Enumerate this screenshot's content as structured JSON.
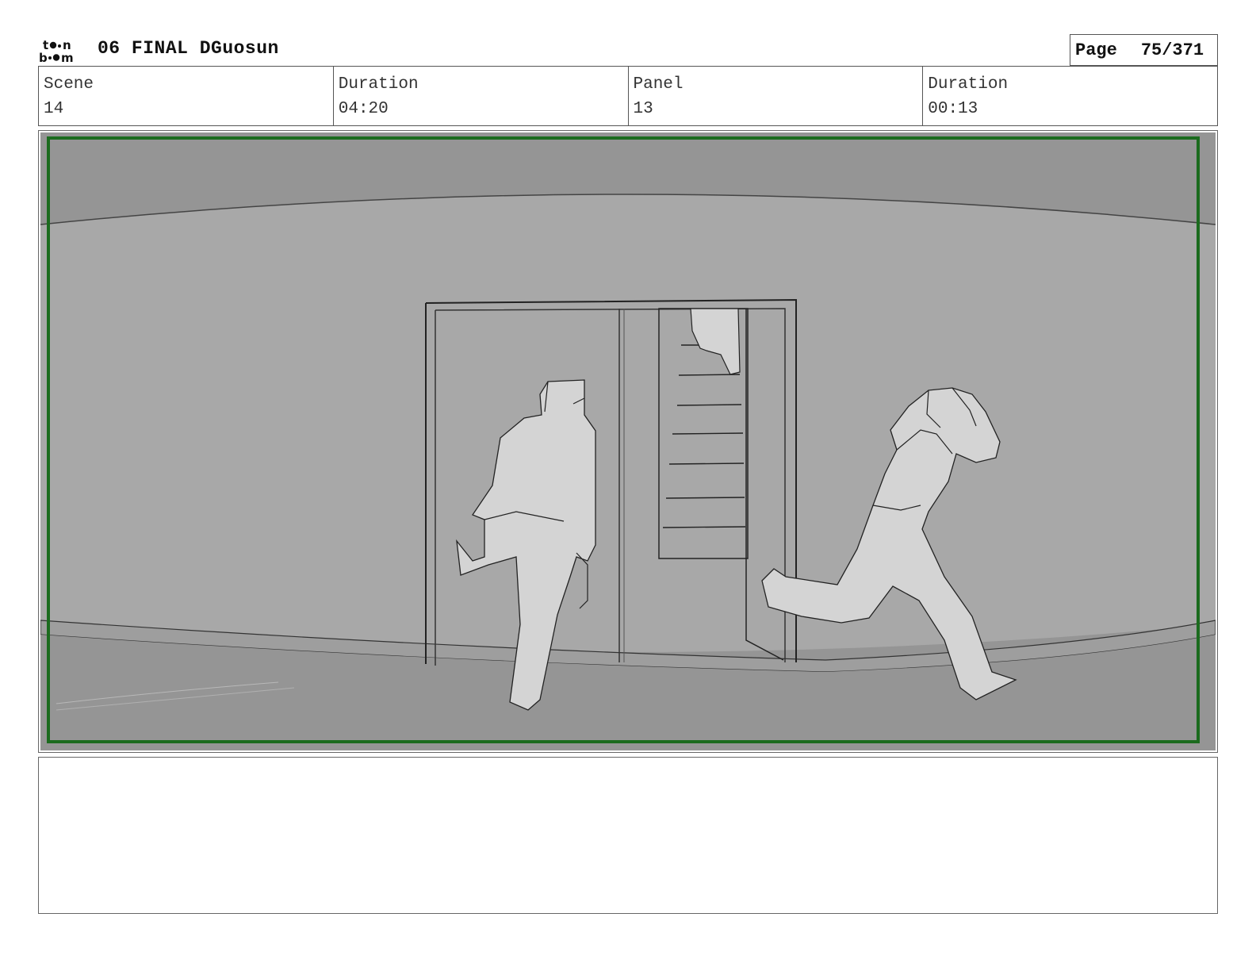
{
  "header": {
    "logo_text_top": "toon",
    "logo_text_bottom": "boom",
    "title": "06 FINAL DGuosun",
    "page_label": "Page",
    "page_value": "75/371"
  },
  "info": [
    {
      "label": "Scene",
      "value": "14"
    },
    {
      "label": "Duration",
      "value": "04:20"
    },
    {
      "label": "Panel",
      "value": "13"
    },
    {
      "label": "Duration",
      "value": "00:13"
    }
  ],
  "panel": {
    "safe_frame_color": "#1b6b1e",
    "wall_color": "#a8a8a8",
    "floor_color": "#959595",
    "figure_color": "#d4d4d4"
  },
  "notes": {
    "text": ""
  }
}
